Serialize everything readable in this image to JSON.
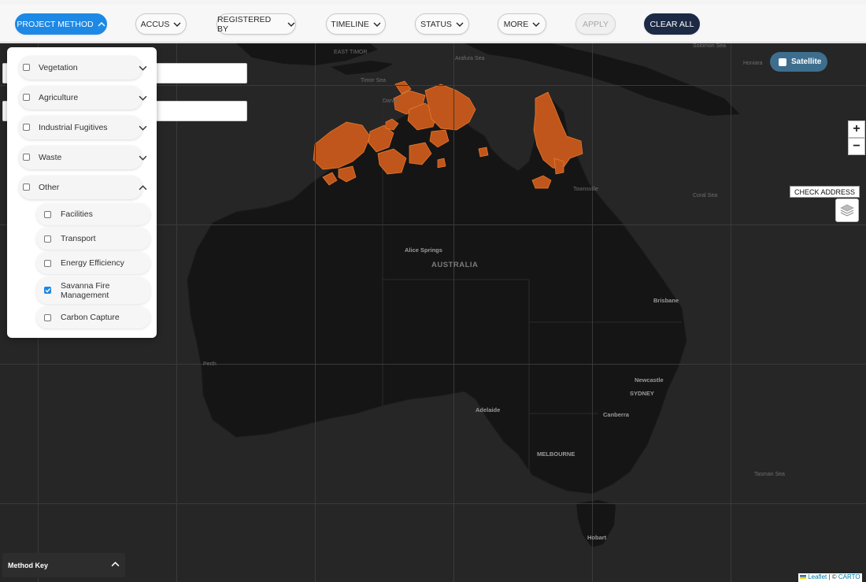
{
  "toolbar": {
    "project_method": "PROJECT METHOD",
    "accus": "ACCUS",
    "registered_by": "REGISTERED BY",
    "timeline": "TIMELINE",
    "status": "STATUS",
    "more": "MORE",
    "apply": "APPLY",
    "clear_all": "CLEAR ALL"
  },
  "colors": {
    "active": "#1e88e5",
    "clear_all": "#1c2a45",
    "map_background": "#262626",
    "land": "#151515",
    "project_fill": "#c0561b",
    "project_stroke": "#f07f2e",
    "satellite_toggle": "#3d6e8e"
  },
  "method_dropdown": {
    "categories": [
      {
        "label": "Vegetation",
        "checked": false,
        "expanded": false
      },
      {
        "label": "Agriculture",
        "checked": false,
        "expanded": false
      },
      {
        "label": "Industrial Fugitives",
        "checked": false,
        "expanded": false
      },
      {
        "label": "Waste",
        "checked": false,
        "expanded": false
      },
      {
        "label": "Other",
        "checked": false,
        "expanded": true
      }
    ],
    "other_items": [
      {
        "label": "Facilities",
        "checked": false
      },
      {
        "label": "Transport",
        "checked": false
      },
      {
        "label": "Energy Efficiency",
        "checked": false
      },
      {
        "label": "Savanna Fire Management",
        "checked": true
      },
      {
        "label": "Carbon Capture",
        "checked": false
      }
    ]
  },
  "map": {
    "satellite_label": "Satellite",
    "check_address_label": "CHECK ADDRESS",
    "zoom_in": "+",
    "zoom_out": "−",
    "labels": {
      "east_timor": "EAST TIMOR",
      "arafura_sea": "Arafura Sea",
      "darwin": "Darwin",
      "timor_sea": "Timor Sea",
      "coral_sea": "Coral Sea",
      "townsville": "Townsville",
      "alice_springs": "Alice Springs",
      "australia": "AUSTRALIA",
      "brisbane": "Brisbane",
      "newcastle": "Newcastle",
      "sydney": "SYDNEY",
      "canberra": "Canberra",
      "adelaide": "Adelaide",
      "melbourne": "MELBOURNE",
      "hobart": "Hobart",
      "perth": "Perth",
      "tasman_sea": "Tasman Sea",
      "honiara": "Honiara",
      "solomon_sea": "Solomon Sea"
    }
  },
  "method_key": {
    "label": "Method Key"
  },
  "attribution": {
    "leaflet": "Leaflet",
    "separator": " | © ",
    "carto": "CARTO"
  }
}
